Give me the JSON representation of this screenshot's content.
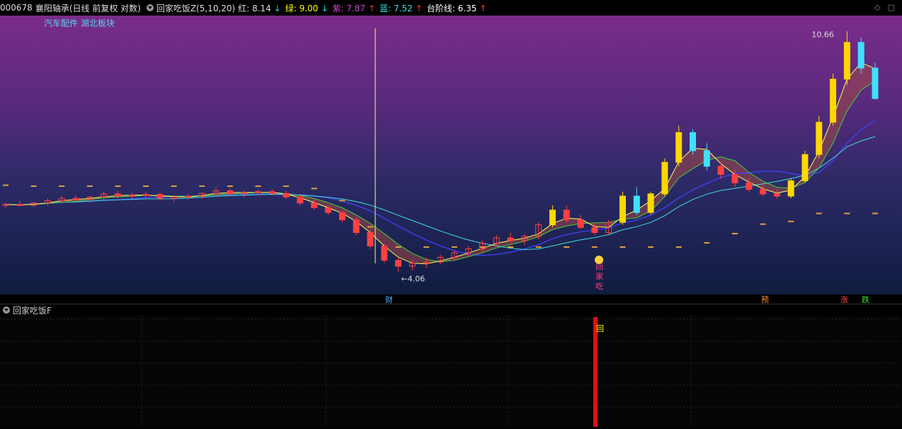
{
  "header": {
    "code": "000678",
    "name": "襄阳轴承",
    "mode": "(日线 前复权 对数)",
    "indicator": "回家吃饭Z(5,10,20)",
    "lines": [
      {
        "label": "红:",
        "value": "8.14",
        "arrow": "↓",
        "color": "#ffffff",
        "arrow_color": "#00e0e0"
      },
      {
        "label": "绿:",
        "value": "9.00",
        "arrow": "↓",
        "color": "#ffff00",
        "arrow_color": "#00e0e0"
      },
      {
        "label": "紫:",
        "value": "7.87",
        "arrow": "↑",
        "color": "#d040d0",
        "arrow_color": "#ff3030"
      },
      {
        "label": "蓝:",
        "value": "7.52",
        "arrow": "↑",
        "color": "#40e0e0",
        "arrow_color": "#ff3030"
      },
      {
        "label": "台阶线:",
        "value": "6.35",
        "arrow": "↑",
        "color": "#ffffff",
        "arrow_color": "#ff3030"
      }
    ]
  },
  "sector": "汽车配件 湖北板块",
  "sub_header": {
    "title": "回家吃饭F"
  },
  "icons": {
    "collapse": "chevron-down-icon",
    "window": "window-control-icons"
  },
  "chart_data": {
    "type": "candlestick",
    "title": "",
    "high_label": "10.66",
    "low_label": "4.06",
    "signal_text": [
      "回",
      "家",
      "吃"
    ],
    "bottom_marks": [
      {
        "text": "财",
        "color": "#4ab0f0"
      },
      {
        "text": "预",
        "color": "#ff9030"
      },
      {
        "text": "涨",
        "color": "#ff4040"
      },
      {
        "text": "跌",
        "color": "#40e040"
      }
    ],
    "sub_signal": "回",
    "step_line_color": "#e0a040",
    "candles": [
      [
        5.3,
        5.35,
        5.25,
        5.32
      ],
      [
        5.32,
        5.4,
        5.28,
        5.3
      ],
      [
        5.3,
        5.38,
        5.26,
        5.35
      ],
      [
        5.35,
        5.45,
        5.3,
        5.4
      ],
      [
        5.4,
        5.5,
        5.35,
        5.45
      ],
      [
        5.45,
        5.52,
        5.38,
        5.42
      ],
      [
        5.42,
        5.5,
        5.36,
        5.48
      ],
      [
        5.48,
        5.6,
        5.42,
        5.55
      ],
      [
        5.55,
        5.62,
        5.45,
        5.5
      ],
      [
        5.5,
        5.58,
        5.44,
        5.52
      ],
      [
        5.52,
        5.6,
        5.46,
        5.54
      ],
      [
        5.54,
        5.58,
        5.4,
        5.45
      ],
      [
        5.45,
        5.52,
        5.38,
        5.48
      ],
      [
        5.48,
        5.55,
        5.42,
        5.5
      ],
      [
        5.5,
        5.58,
        5.44,
        5.56
      ],
      [
        5.56,
        5.7,
        5.5,
        5.62
      ],
      [
        5.62,
        5.68,
        5.5,
        5.55
      ],
      [
        5.55,
        5.62,
        5.48,
        5.58
      ],
      [
        5.58,
        5.65,
        5.52,
        5.6
      ],
      [
        5.6,
        5.66,
        5.52,
        5.56
      ],
      [
        5.56,
        5.62,
        5.44,
        5.48
      ],
      [
        5.48,
        5.55,
        5.3,
        5.35
      ],
      [
        5.35,
        5.42,
        5.2,
        5.25
      ],
      [
        5.25,
        5.3,
        5.1,
        5.15
      ],
      [
        5.15,
        5.2,
        4.95,
        5.0
      ],
      [
        5.0,
        5.05,
        4.7,
        4.75
      ],
      [
        4.75,
        4.8,
        4.45,
        4.5
      ],
      [
        4.5,
        4.55,
        4.2,
        4.25
      ],
      [
        4.25,
        4.3,
        4.06,
        4.15
      ],
      [
        4.15,
        4.25,
        4.08,
        4.2
      ],
      [
        4.2,
        4.3,
        4.12,
        4.22
      ],
      [
        4.22,
        4.35,
        4.18,
        4.3
      ],
      [
        4.3,
        4.42,
        4.25,
        4.38
      ],
      [
        4.38,
        4.5,
        4.32,
        4.45
      ],
      [
        4.45,
        4.6,
        4.4,
        4.55
      ],
      [
        4.55,
        4.7,
        4.5,
        4.65
      ],
      [
        4.65,
        4.75,
        4.55,
        4.6
      ],
      [
        4.6,
        4.72,
        4.52,
        4.68
      ],
      [
        4.68,
        4.95,
        4.62,
        4.9
      ],
      [
        4.9,
        5.3,
        4.85,
        5.2
      ],
      [
        5.2,
        5.3,
        4.95,
        5.0
      ],
      [
        5.0,
        5.1,
        4.82,
        4.85
      ],
      [
        4.85,
        4.95,
        4.7,
        4.75
      ],
      [
        4.75,
        5.0,
        4.72,
        4.95
      ],
      [
        4.95,
        5.6,
        4.9,
        5.5
      ],
      [
        5.5,
        5.7,
        5.1,
        5.15
      ],
      [
        5.15,
        5.6,
        5.1,
        5.55
      ],
      [
        5.55,
        6.4,
        5.5,
        6.3
      ],
      [
        6.3,
        7.3,
        6.2,
        7.1
      ],
      [
        7.1,
        7.2,
        6.5,
        6.6
      ],
      [
        6.6,
        6.8,
        6.1,
        6.2
      ],
      [
        6.2,
        6.3,
        5.9,
        6.0
      ],
      [
        6.0,
        6.1,
        5.7,
        5.8
      ],
      [
        5.8,
        5.9,
        5.6,
        5.65
      ],
      [
        5.65,
        5.75,
        5.5,
        5.55
      ],
      [
        5.55,
        5.65,
        5.45,
        5.5
      ],
      [
        5.5,
        5.9,
        5.45,
        5.85
      ],
      [
        5.85,
        6.6,
        5.8,
        6.5
      ],
      [
        6.5,
        7.6,
        6.4,
        7.4
      ],
      [
        7.4,
        9.0,
        7.3,
        8.8
      ],
      [
        8.8,
        10.66,
        8.6,
        10.2
      ],
      [
        10.2,
        10.4,
        9.0,
        9.2
      ],
      [
        9.2,
        9.4,
        8.1,
        8.14
      ]
    ]
  }
}
